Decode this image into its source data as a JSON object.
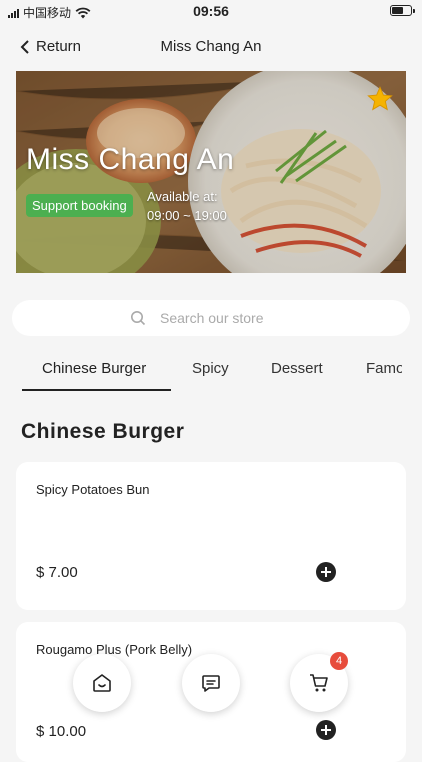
{
  "status_bar": {
    "carrier": "中国移动",
    "time": "09:56"
  },
  "nav": {
    "back_label": "Return",
    "title": "Miss Chang An"
  },
  "store": {
    "name": "Miss Chang An",
    "booking_badge": "Support booking",
    "available_label": "Available at:",
    "hours": "09:00 ~ 19:00",
    "favorite_icon": "star-icon"
  },
  "search": {
    "placeholder": "Search our store",
    "icon": "search-icon"
  },
  "tabs": [
    {
      "label": "Chinese Burger",
      "active": true
    },
    {
      "label": "Spicy"
    },
    {
      "label": "Dessert"
    },
    {
      "label": "Famous"
    }
  ],
  "section": {
    "title": "Chinese Burger"
  },
  "products": [
    {
      "name": "Spicy Potatoes Bun",
      "price": "$ 7.00"
    },
    {
      "name": "Rougamo Plus (Pork Belly)",
      "price": "$ 10.00"
    }
  ],
  "bottom_bar": {
    "home_icon": "home-icon",
    "chat_icon": "chat-icon",
    "cart_icon": "cart-icon",
    "cart_count": "4"
  },
  "colors": {
    "accent_green": "#4caf50",
    "badge_red": "#e74c3c",
    "star": "#f5b301"
  }
}
